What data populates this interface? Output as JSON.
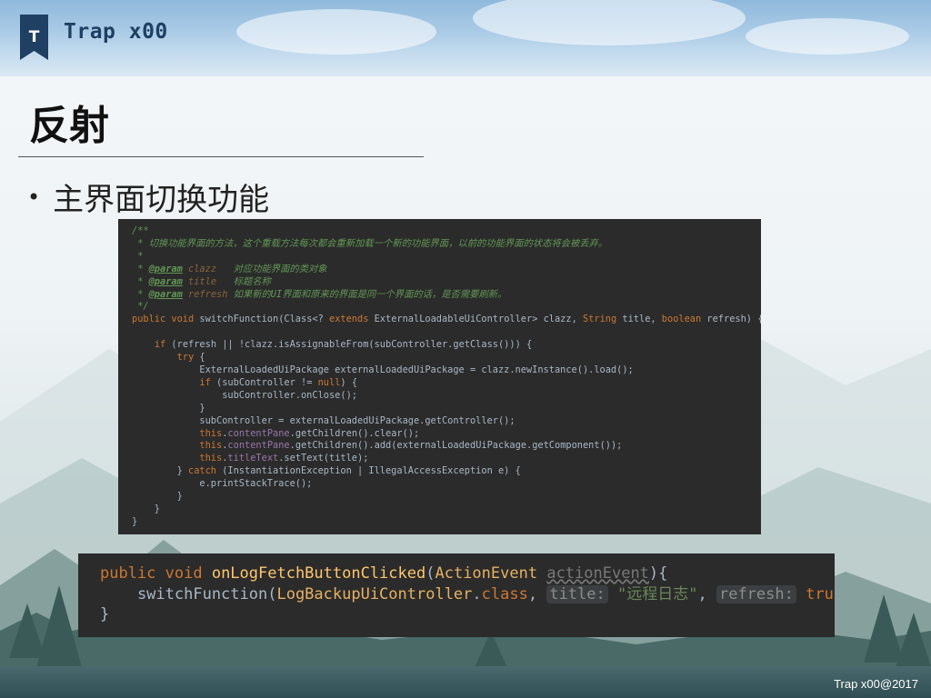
{
  "header": {
    "logo_letter": "T",
    "brand": "Trap x00"
  },
  "slide": {
    "title": "反射",
    "bullet": "主界面切换功能"
  },
  "code_block_1": {
    "lines": [
      [
        [
          "cm",
          "/**"
        ]
      ],
      [
        [
          "cm",
          " * 切换功能界面的方法，这个重载方法每次都会重新加载一个新的功能界面，以前的功能界面的状态将会被丢弃。"
        ]
      ],
      [
        [
          "cm",
          " *"
        ]
      ],
      [
        [
          "cm",
          " * "
        ],
        [
          "cmtag",
          "@param"
        ],
        [
          "cm",
          " "
        ],
        [
          "pname",
          "clazz"
        ],
        [
          "cm",
          "   对应功能界面的类对象"
        ]
      ],
      [
        [
          "cm",
          " * "
        ],
        [
          "cmtag",
          "@param"
        ],
        [
          "cm",
          " "
        ],
        [
          "pname",
          "title"
        ],
        [
          "cm",
          "   标题名称"
        ]
      ],
      [
        [
          "cm",
          " * "
        ],
        [
          "cmtag",
          "@param"
        ],
        [
          "cm",
          " "
        ],
        [
          "pname",
          "refresh"
        ],
        [
          "cm",
          " 如果新的UI界面和原来的界面是同一个界面的话，是否需要刷新。"
        ]
      ],
      [
        [
          "cm",
          " */"
        ]
      ],
      [
        [
          "kw",
          "public void "
        ],
        [
          "txt",
          "switchFunction(Class<? "
        ],
        [
          "kw",
          "extends "
        ],
        [
          "txt",
          "ExternalLoadableUiController> clazz, "
        ],
        [
          "kw",
          "String "
        ],
        [
          "txt",
          "title, "
        ],
        [
          "kw",
          "boolean "
        ],
        [
          "txt",
          "refresh) {"
        ]
      ],
      [
        [
          "txt",
          ""
        ]
      ],
      [
        [
          "txt",
          "    "
        ],
        [
          "kw",
          "if "
        ],
        [
          "txt",
          "(refresh || !clazz.isAssignableFrom(subController.getClass())) {"
        ]
      ],
      [
        [
          "txt",
          "        "
        ],
        [
          "kw",
          "try "
        ],
        [
          "txt",
          "{"
        ]
      ],
      [
        [
          "txt",
          "            ExternalLoadedUiPackage externalLoadedUiPackage = clazz.newInstance().load();"
        ]
      ],
      [
        [
          "txt",
          "            "
        ],
        [
          "kw",
          "if "
        ],
        [
          "txt",
          "(subController != "
        ],
        [
          "kw",
          "null"
        ],
        [
          "txt",
          ") {"
        ]
      ],
      [
        [
          "txt",
          "                subController.onClose();"
        ]
      ],
      [
        [
          "txt",
          "            }"
        ]
      ],
      [
        [
          "txt",
          "            subController = externalLoadedUiPackage.getController();"
        ]
      ],
      [
        [
          "txt",
          "            "
        ],
        [
          "kw",
          "this"
        ],
        [
          "txt",
          "."
        ],
        [
          "fld",
          "contentPane"
        ],
        [
          "txt",
          ".getChildren().clear();"
        ]
      ],
      [
        [
          "txt",
          "            "
        ],
        [
          "kw",
          "this"
        ],
        [
          "txt",
          "."
        ],
        [
          "fld",
          "contentPane"
        ],
        [
          "txt",
          ".getChildren().add(externalLoadedUiPackage.getComponent());"
        ]
      ],
      [
        [
          "txt",
          "            "
        ],
        [
          "kw",
          "this"
        ],
        [
          "txt",
          "."
        ],
        [
          "fld",
          "titleText"
        ],
        [
          "txt",
          ".setText(title);"
        ]
      ],
      [
        [
          "txt",
          "        } "
        ],
        [
          "kw",
          "catch "
        ],
        [
          "txt",
          "(InstantiationException | IllegalAccessException e) {"
        ]
      ],
      [
        [
          "txt",
          "            e.printStackTrace();"
        ]
      ],
      [
        [
          "txt",
          "        }"
        ]
      ],
      [
        [
          "txt",
          "    }"
        ]
      ],
      [
        [
          "txt",
          "}"
        ]
      ]
    ]
  },
  "code_block_2": {
    "lines": [
      [
        [
          "kw",
          "public void "
        ],
        [
          "fn",
          "onLogFetchButtonClicked"
        ],
        [
          "txt",
          "("
        ],
        [
          "cls",
          "ActionEvent"
        ],
        [
          "txt",
          " "
        ],
        [
          "unused",
          "actionEvent"
        ],
        [
          "txt",
          "){"
        ]
      ],
      [
        [
          "txt",
          "    switchFunction("
        ],
        [
          "cls",
          "LogBackupUiController"
        ],
        [
          "txt",
          "."
        ],
        [
          "kw",
          "class"
        ],
        [
          "txt",
          ", "
        ],
        [
          "hint",
          "title:"
        ],
        [
          "txt",
          " "
        ],
        [
          "str",
          "\"远程日志\""
        ],
        [
          "txt",
          ", "
        ],
        [
          "hint",
          "refresh:"
        ],
        [
          "txt",
          " "
        ],
        [
          "kw",
          "true"
        ],
        [
          "txt",
          ");"
        ]
      ],
      [
        [
          "txt",
          "}"
        ]
      ]
    ]
  },
  "footer": {
    "text": "Trap x00@2017"
  },
  "colors": {
    "code_bg": "#2b2b2b",
    "keyword": "#cc7832",
    "comment": "#629755",
    "brand": "#1f3f63"
  }
}
